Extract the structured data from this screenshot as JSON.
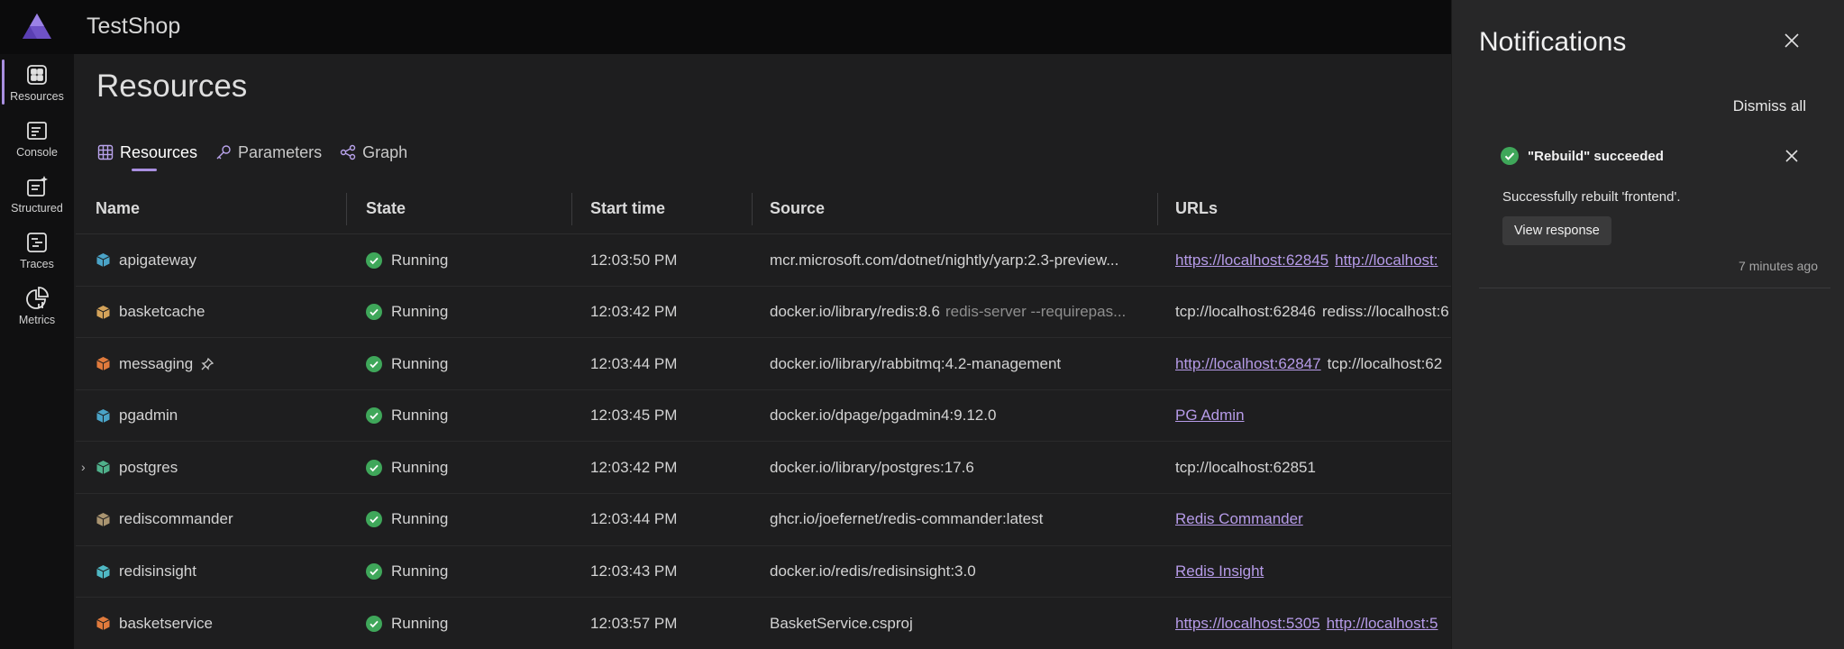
{
  "app": {
    "title": "TestShop"
  },
  "rail": [
    {
      "label": "Resources",
      "icon": "resources-icon"
    },
    {
      "label": "Console",
      "icon": "console-icon"
    },
    {
      "label": "Structured",
      "icon": "structured-icon"
    },
    {
      "label": "Traces",
      "icon": "traces-icon"
    },
    {
      "label": "Metrics",
      "icon": "metrics-icon"
    }
  ],
  "page": {
    "title": "Resources"
  },
  "tabs": [
    {
      "label": "Resources",
      "icon": "table-icon"
    },
    {
      "label": "Parameters",
      "icon": "key-icon"
    },
    {
      "label": "Graph",
      "icon": "graph-icon"
    }
  ],
  "columns": [
    "Name",
    "State",
    "Start time",
    "Source",
    "URLs"
  ],
  "rows": [
    {
      "name": "apigateway",
      "state": "Running",
      "start": "12:03:50 PM",
      "source": "mcr.microsoft.com/dotnet/nightly/yarp:2.3-preview...",
      "source_args": "",
      "urls": [
        {
          "text": "https://localhost:62845",
          "link": true
        },
        {
          "text": "http://localhost:",
          "link": true
        }
      ]
    },
    {
      "name": "basketcache",
      "state": "Running",
      "start": "12:03:42 PM",
      "source": "docker.io/library/redis:8.6",
      "source_args": "redis-server --requirepas...",
      "urls": [
        {
          "text": "tcp://localhost:62846",
          "link": false
        },
        {
          "text": "rediss://localhost:6",
          "link": false
        }
      ]
    },
    {
      "name": "messaging",
      "state": "Running",
      "start": "12:03:44 PM",
      "source": "docker.io/library/rabbitmq:4.2-management",
      "source_args": "",
      "urls": [
        {
          "text": "http://localhost:62847",
          "link": true
        },
        {
          "text": "tcp://localhost:62",
          "link": false
        }
      ]
    },
    {
      "name": "pgadmin",
      "state": "Running",
      "start": "12:03:45 PM",
      "source": "docker.io/dpage/pgadmin4:9.12.0",
      "source_args": "",
      "urls": [
        {
          "text": "PG Admin",
          "link": true
        }
      ]
    },
    {
      "name": "postgres",
      "state": "Running",
      "start": "12:03:42 PM",
      "source": "docker.io/library/postgres:17.6",
      "source_args": "",
      "urls": [
        {
          "text": "tcp://localhost:62851",
          "link": false
        }
      ]
    },
    {
      "name": "rediscommander",
      "state": "Running",
      "start": "12:03:44 PM",
      "source": "ghcr.io/joefernet/redis-commander:latest",
      "source_args": "",
      "urls": [
        {
          "text": "Redis Commander",
          "link": true
        }
      ]
    },
    {
      "name": "redisinsight",
      "state": "Running",
      "start": "12:03:43 PM",
      "source": "docker.io/redis/redisinsight:3.0",
      "source_args": "",
      "urls": [
        {
          "text": "Redis Insight",
          "link": true
        }
      ]
    },
    {
      "name": "basketservice",
      "state": "Running",
      "start": "12:03:57 PM",
      "source": "BasketService.csproj",
      "source_args": "",
      "urls": [
        {
          "text": "https://localhost:5305",
          "link": true
        },
        {
          "text": "http://localhost:5",
          "link": true
        }
      ]
    }
  ],
  "row_icon_colors": [
    "#4aa3c7",
    "#d4a35a",
    "#e07a3c",
    "#4aa3c7",
    "#4fb08a",
    "#a99470",
    "#4fb8c4",
    "#e07a3c"
  ],
  "notifications": {
    "title": "Notifications",
    "dismiss_all": "Dismiss all",
    "items": [
      {
        "title": "\"Rebuild\" succeeded",
        "message": "Successfully rebuilt 'frontend'.",
        "action": "View response",
        "time": "7 minutes ago"
      }
    ]
  },
  "colors": {
    "accent": "#a98fe0",
    "success": "#3fa75a",
    "link": "#b69be8"
  }
}
